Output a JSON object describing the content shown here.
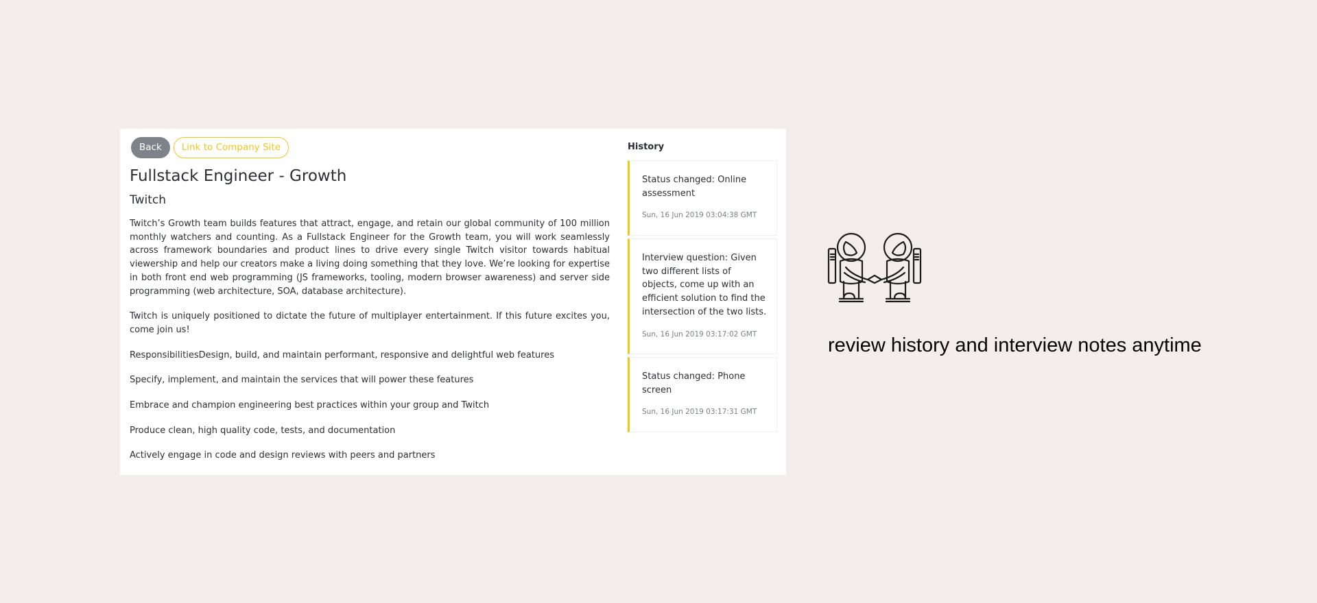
{
  "toolbar": {
    "back_label": "Back",
    "company_link_label": "Link to Company Site"
  },
  "job": {
    "title": "Fullstack Engineer - Growth",
    "company": "Twitch",
    "paragraphs": [
      "Twitch’s Growth team builds features that attract, engage, and retain our global community of 100 million monthly watchers and counting. As a Fullstack Engineer for the Growth team, you will work seamlessly across framework boundaries and product lines to drive every single Twitch visitor towards habitual viewership and help our creators make a living doing something that they love. We’re looking for expertise in both front end web programming (JS frameworks, tooling, modern browser awareness) and server side programming (web architecture, SOA, database architecture).",
      "Twitch is uniquely positioned to dictate the future of multiplayer entertainment. If this future excites you, come join us!",
      "ResponsibilitiesDesign, build, and maintain performant, responsive and delightful web features",
      "Specify, implement, and maintain the services that will power these features",
      "Embrace and champion engineering best practices within your group and Twitch",
      "Produce clean, high quality code, tests, and documentation",
      "Actively engage in code and design reviews with peers and partners"
    ]
  },
  "history": {
    "title": "History",
    "entries": [
      {
        "text": "Status changed: Online assessment",
        "timestamp": "Sun, 16 Jun 2019 03:04:38 GMT"
      },
      {
        "text": "Interview question: Given two different lists of objects, come up with an efficient solution to find the intersection of the two lists.",
        "timestamp": "Sun, 16 Jun 2019 03:17:02 GMT"
      },
      {
        "text": "Status changed: Phone screen",
        "timestamp": "Sun, 16 Jun 2019 03:17:31 GMT"
      }
    ]
  },
  "promo": {
    "icon": "astronauts-handshake-icon",
    "text": "review history and interview notes anytime"
  },
  "colors": {
    "accent": "#f5c518",
    "background": "#f4eded",
    "secondary_button": "#7d8388"
  }
}
